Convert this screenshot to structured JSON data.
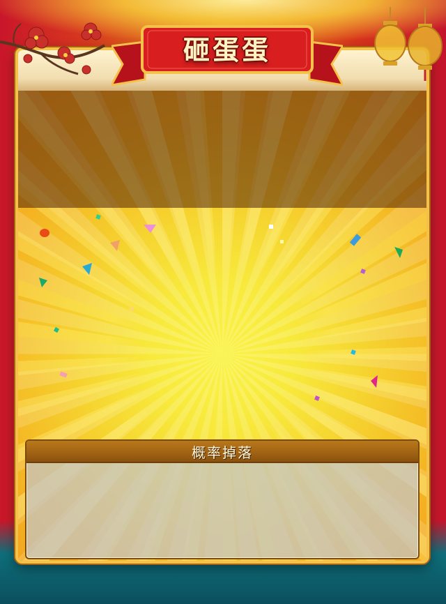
{
  "game": {
    "title": "砸蛋蛋",
    "drop_rate_panel": {
      "header": "概率掉落"
    }
  },
  "colors": {
    "frame_gold": "#f4c14a",
    "banner_red": "#d81e1e",
    "burst_yellow": "#f8e93c",
    "panel_header_brown": "#a26414",
    "panel_body_gray": "#c4c4c4"
  },
  "decorations": {
    "left": "plum-blossom-branch-icon",
    "right": "red-lantern-icon",
    "confetti": "confetti-pieces"
  }
}
